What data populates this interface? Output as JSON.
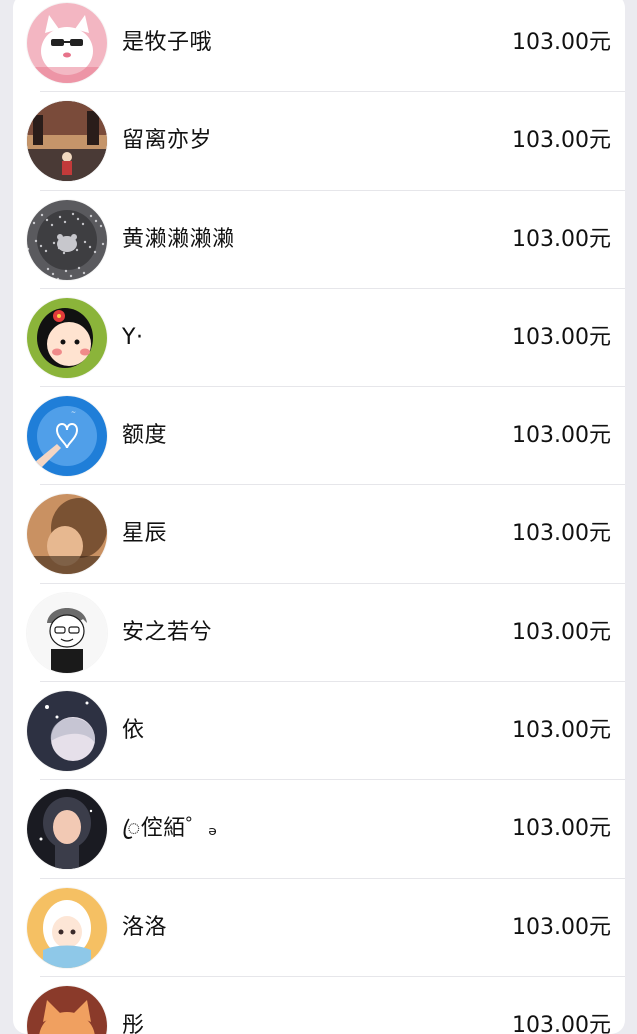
{
  "currency_suffix": "元",
  "rows": [
    {
      "name": "是牧子哦",
      "amount": "103.00元",
      "avatar": "white-cat-sunglasses-avatar-icon",
      "colors": [
        "#f3b6c2",
        "#ffffff",
        "#e7738a"
      ]
    },
    {
      "name": "留离亦岁",
      "amount": "103.00元",
      "avatar": "street-scene-avatar-icon",
      "colors": [
        "#7a4b3a",
        "#e9b07a",
        "#3b2a28"
      ]
    },
    {
      "name": "黄濑濑濑濑",
      "amount": "103.00元",
      "avatar": "glitter-bear-avatar-icon",
      "colors": [
        "#5a5a5e",
        "#c7c7cc",
        "#2b2b2e"
      ]
    },
    {
      "name": "Y·",
      "amount": "103.00元",
      "avatar": "cartoon-girl-avatar-icon",
      "colors": [
        "#8bb43a",
        "#ffe3d0",
        "#111111"
      ]
    },
    {
      "name": "额度",
      "amount": "103.00元",
      "avatar": "hand-heart-avatar-icon",
      "colors": [
        "#1f7ed8",
        "#8cc8ff",
        "#ffffff"
      ]
    },
    {
      "name": "星辰",
      "amount": "103.00元",
      "avatar": "girl-portrait-avatar-icon",
      "colors": [
        "#c99162",
        "#7a5233",
        "#3a2618"
      ]
    },
    {
      "name": "安之若兮",
      "amount": "103.00元",
      "avatar": "sketch-boy-avatar-icon",
      "colors": [
        "#f7f7f7",
        "#1a1a1a",
        "#6b6b6b"
      ]
    },
    {
      "name": "依",
      "amount": "103.00元",
      "avatar": "dreamy-girl-avatar-icon",
      "colors": [
        "#2d3142",
        "#b8b9c9",
        "#e6e0ea"
      ]
    },
    {
      "name": "ꦿ倥絔゜ₔ",
      "amount": "103.00元",
      "avatar": "dark-hair-girl-avatar-icon",
      "colors": [
        "#1a1b22",
        "#f2c9b4",
        "#3b3d4a"
      ]
    },
    {
      "name": "洛洛",
      "amount": "103.00元",
      "avatar": "anime-girl-avatar-icon",
      "colors": [
        "#f5c063",
        "#ffffff",
        "#8ec8e8"
      ]
    },
    {
      "name": "彤",
      "amount": "103.00元",
      "avatar": "orange-cat-avatar-icon",
      "colors": [
        "#8a3a2a",
        "#f0a060",
        "#ffffff"
      ]
    }
  ]
}
